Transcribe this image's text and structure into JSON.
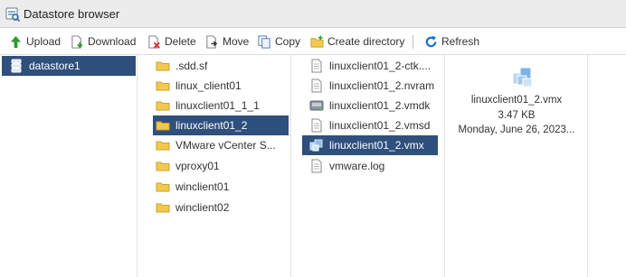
{
  "window": {
    "title": "Datastore browser"
  },
  "toolbar": {
    "upload": "Upload",
    "download": "Download",
    "delete": "Delete",
    "move": "Move",
    "copy": "Copy",
    "create_directory": "Create directory",
    "refresh": "Refresh"
  },
  "datastores": [
    {
      "label": "datastore1",
      "selected": true
    }
  ],
  "folders": [
    {
      "label": ".sdd.sf"
    },
    {
      "label": "linux_client01"
    },
    {
      "label": "linuxclient01_1_1"
    },
    {
      "label": "linuxclient01_2",
      "selected": true
    },
    {
      "label": "VMware vCenter S..."
    },
    {
      "label": "vproxy01"
    },
    {
      "label": "winclient01"
    },
    {
      "label": "winclient02"
    }
  ],
  "files": [
    {
      "label": "linuxclient01_2-ctk....",
      "icon": "file-icon"
    },
    {
      "label": "linuxclient01_2.nvram",
      "icon": "file-icon"
    },
    {
      "label": "linuxclient01_2.vmdk",
      "icon": "disk-icon"
    },
    {
      "label": "linuxclient01_2.vmsd",
      "icon": "file-icon"
    },
    {
      "label": "linuxclient01_2.vmx",
      "icon": "vm-icon",
      "selected": true
    },
    {
      "label": "vmware.log",
      "icon": "file-icon"
    }
  ],
  "details": {
    "name": "linuxclient01_2.vmx",
    "size": "3.47 KB",
    "modified": "Monday, June 26, 2023..."
  },
  "colors": {
    "selection": "#2f4f7c",
    "folder": "#f3c94c",
    "refresh": "#1a6fd1",
    "upload": "#2e9a2e"
  }
}
